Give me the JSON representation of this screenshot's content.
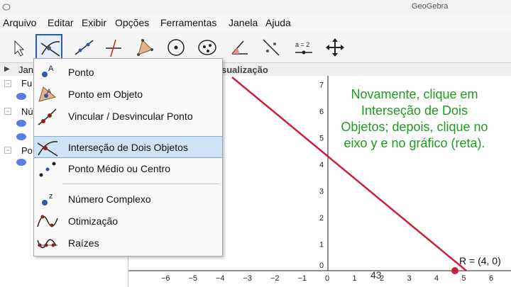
{
  "window": {
    "title": "GeoGebra"
  },
  "menubar": {
    "items": [
      "Arquivo",
      "Editar",
      "Exibir",
      "Opções",
      "Ferramentas",
      "Janela",
      "Ajuda"
    ]
  },
  "algebra": {
    "header": "Jan",
    "nodes": [
      "Fu",
      "Nú",
      "Po"
    ]
  },
  "graphics": {
    "header": "sualização",
    "x_ticks": [
      "−6",
      "−5",
      "−4",
      "−3",
      "−2",
      "−1",
      "0",
      "1",
      "2",
      "3",
      "4",
      "5",
      "6"
    ],
    "y_ticks": [
      "7",
      "6",
      "5",
      "4",
      "3",
      "2",
      "1",
      "0"
    ],
    "point_label": "R = (4, 0)",
    "line_color": "#cc1f3a"
  },
  "dropdown": {
    "items": [
      {
        "label": "Ponto"
      },
      {
        "label": "Ponto em Objeto"
      },
      {
        "label": "Vincular / Desvincular Ponto"
      },
      {
        "label": "Interseção de Dois Objetos"
      },
      {
        "label": "Ponto Médio ou Centro"
      },
      {
        "label": "Número Complexo"
      },
      {
        "label": "Otimização"
      },
      {
        "label": "Raízes"
      }
    ]
  },
  "note": {
    "text": "Novamente, clique em Interseção de Dois Objetos; depois, clique no eixo y e no gráfico (reta)."
  },
  "slide": {
    "page_number": "43"
  },
  "toolbar": {
    "slider_label": "a = 2"
  }
}
